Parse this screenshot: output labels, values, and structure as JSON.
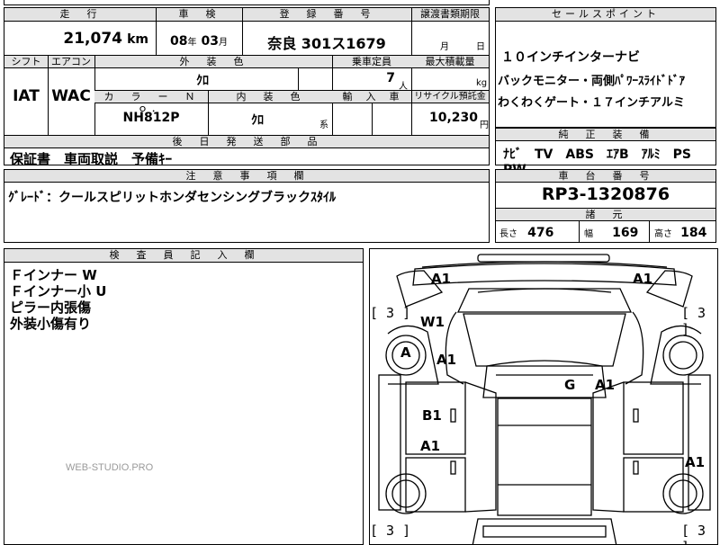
{
  "header": {
    "mileage_label": "走　行",
    "inspection_label": "車　検",
    "registration_label": "登　録　番　号",
    "transfer_label": "譲渡書類期限",
    "sales_point_label": "セールスポイント"
  },
  "vehicle": {
    "mileage_value": "21,074",
    "mileage_unit": "km",
    "inspection_year": "08",
    "inspection_year_unit": "年",
    "inspection_month": "03",
    "inspection_month_unit": "月",
    "plate": "奈良 301ス1679",
    "transfer_month_unit": "月",
    "transfer_day_unit": "日"
  },
  "row2": {
    "shift_label": "シフト",
    "ac_label": "エアコン",
    "exterior_label": "外　装　色",
    "capacity_label": "乗車定員",
    "load_label": "最大積載量",
    "shift_value": "IAT",
    "ac_value": "WAC",
    "exterior_value": "ｸﾛ",
    "capacity_value": "7",
    "capacity_unit": "人",
    "load_unit": "kg",
    "color_no_label": "カ　ラ　ー　Ｎ　ｏ．",
    "interior_label": "内　装　色",
    "import_label": "輸　入　車",
    "recycle_label": "リサイクル預託金",
    "color_no_value": "NH812P",
    "interior_value": "ｸﾛ",
    "interior_unit": "系",
    "recycle_value": "10,230",
    "recycle_unit": "円"
  },
  "sales_points": [
    "１０インチインターナビ",
    "バックモニター・両側ﾊﾟﾜｰｽﾗｲﾄﾞﾄﾞｱ",
    "わくわくゲート・１７インチアルミ"
  ],
  "accessories": {
    "label": "後　日　発　送　部　品",
    "value": "保証書　車両取説　予備ｷｰ"
  },
  "standard_equipment": {
    "label": "純　正　装　備",
    "value": "ﾅﾋﾞ　TV　ABS　ｴｱB　ｱﾙﾐ　PS　PW"
  },
  "notes": {
    "label": "注　意　事　項　欄",
    "value": "ｸﾞﾚｰﾄﾞ：クールスピリットホンダセンシングブラックｽﾀｲﾙ"
  },
  "chassis": {
    "label": "車　台　番　号",
    "value": "RP3-1320876"
  },
  "specs": {
    "label": "諸　元",
    "length_label": "長さ",
    "length_value": "476",
    "width_label": "幅",
    "width_value": "169",
    "height_label": "高さ",
    "height_value": "184"
  },
  "inspector": {
    "label": "検　査　員　記　入　欄",
    "lines": [
      "Ｆインナー W",
      "Ｆインナー小 U",
      "ピラー内張傷",
      "外装小傷有り"
    ]
  },
  "watermark": "WEB-STUDIO.PRO",
  "diagram_marks": {
    "a1_front_left": "A1",
    "a1_front_right": "A1",
    "w1": "W1",
    "a_wheel": "A",
    "a1_left_fender": "A1",
    "g": "G",
    "a1_right": "A1",
    "b1": "B1",
    "a1_left_door": "A1",
    "a1_right_low": "A1",
    "bracket_tl": "[ 3 ]",
    "bracket_tr": "[ 3 ]",
    "bracket_bl": "[ 3 ]",
    "bracket_br": "[ 3 ]"
  }
}
